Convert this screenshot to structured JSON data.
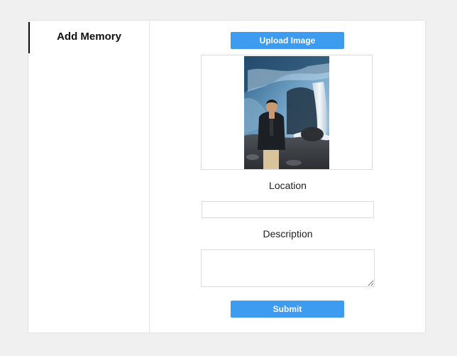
{
  "sidebar": {
    "items": [
      {
        "label": "Add Memory",
        "active": true
      }
    ]
  },
  "form": {
    "upload_button_label": "Upload Image",
    "image": {
      "alt": "",
      "subject": "person in dark jacket standing in front of an ice cave and waterfall"
    },
    "location": {
      "label": "Location",
      "value": "",
      "placeholder": ""
    },
    "description": {
      "label": "Description",
      "value": "",
      "placeholder": ""
    },
    "submit_button_label": "Submit"
  },
  "colors": {
    "page_background": "#f0f0f0",
    "card_background": "#ffffff",
    "button_accent": "#3d9bf0",
    "button_text": "#ffffff",
    "active_indicator": "#111111"
  }
}
